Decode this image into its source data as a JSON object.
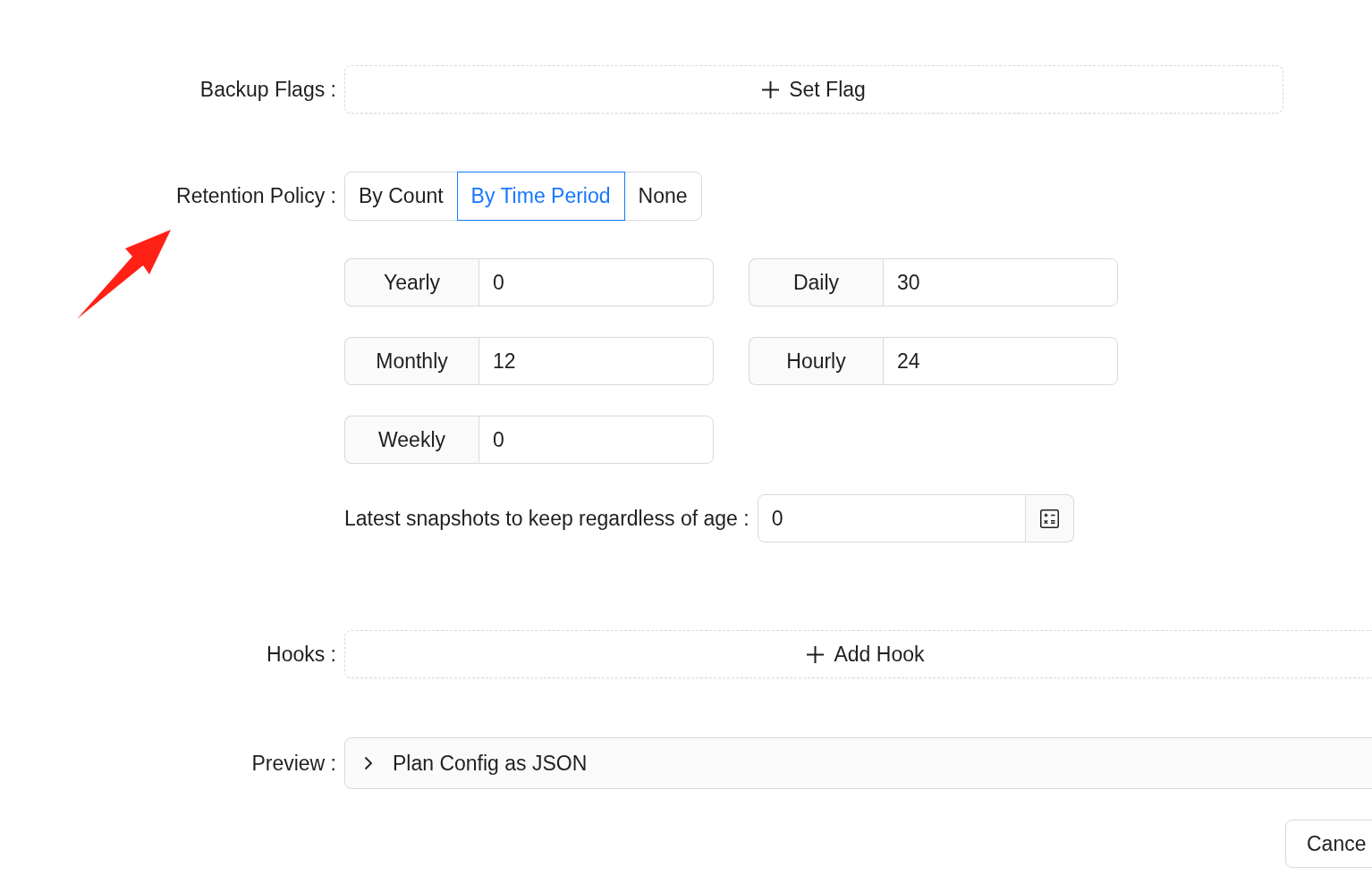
{
  "backup_flags": {
    "label": "Backup Flags :",
    "add_button": "Set Flag"
  },
  "retention_policy": {
    "label": "Retention Policy :",
    "options": [
      {
        "label": "By Count",
        "selected": false
      },
      {
        "label": "By Time Period",
        "selected": true
      },
      {
        "label": "None",
        "selected": false
      }
    ]
  },
  "time_period_fields": {
    "columns": [
      {
        "fields": [
          {
            "label": "Yearly",
            "value": "0"
          },
          {
            "label": "Monthly",
            "value": "12"
          },
          {
            "label": "Weekly",
            "value": "0"
          }
        ]
      },
      {
        "fields": [
          {
            "label": "Daily",
            "value": "30"
          },
          {
            "label": "Hourly",
            "value": "24"
          }
        ]
      }
    ]
  },
  "keep_latest": {
    "label": "Latest snapshots to keep regardless of age :",
    "value": "0"
  },
  "hooks": {
    "label": "Hooks :",
    "add_button": "Add Hook"
  },
  "preview": {
    "label": "Preview :",
    "panel_title": "Plan Config as JSON",
    "expanded": false
  },
  "footer": {
    "buttons": [
      "Cance"
    ]
  }
}
